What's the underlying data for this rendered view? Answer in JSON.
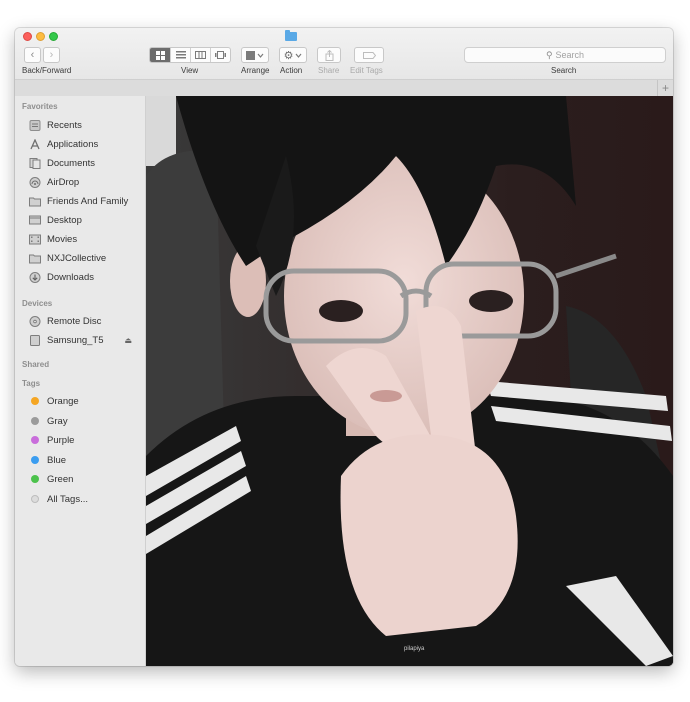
{
  "toolbar": {
    "back_forward_label": "Back/Forward",
    "view_label": "View",
    "arrange_label": "Arrange",
    "action_label": "Action",
    "share_label": "Share",
    "edit_tags_label": "Edit Tags",
    "search_label": "Search",
    "search_placeholder": "Search"
  },
  "sidebar": {
    "favorites_header": "Favorites",
    "favorites": [
      {
        "label": "Recents",
        "icon": "recents-icon"
      },
      {
        "label": "Applications",
        "icon": "applications-icon"
      },
      {
        "label": "Documents",
        "icon": "documents-icon"
      },
      {
        "label": "AirDrop",
        "icon": "airdrop-icon"
      },
      {
        "label": "Friends And Family",
        "icon": "folder-icon"
      },
      {
        "label": "Desktop",
        "icon": "desktop-icon"
      },
      {
        "label": "Movies",
        "icon": "movies-icon"
      },
      {
        "label": "NXJCollective",
        "icon": "folder-icon"
      },
      {
        "label": "Downloads",
        "icon": "downloads-icon"
      }
    ],
    "devices_header": "Devices",
    "devices": [
      {
        "label": "Remote Disc",
        "icon": "disc-icon"
      },
      {
        "label": "Samsung_T5",
        "icon": "drive-icon"
      }
    ],
    "shared_header": "Shared",
    "tags_header": "Tags",
    "tags": [
      {
        "label": "Orange",
        "color": "#f5a623"
      },
      {
        "label": "Gray",
        "color": "#9b9b9b"
      },
      {
        "label": "Purple",
        "color": "#c96ddb"
      },
      {
        "label": "Blue",
        "color": "#3b9df0"
      },
      {
        "label": "Green",
        "color": "#4cc24c"
      },
      {
        "label": "All Tags...",
        "color": "#dcdcdc"
      }
    ]
  },
  "content": {
    "watermark": "pilapiya"
  }
}
